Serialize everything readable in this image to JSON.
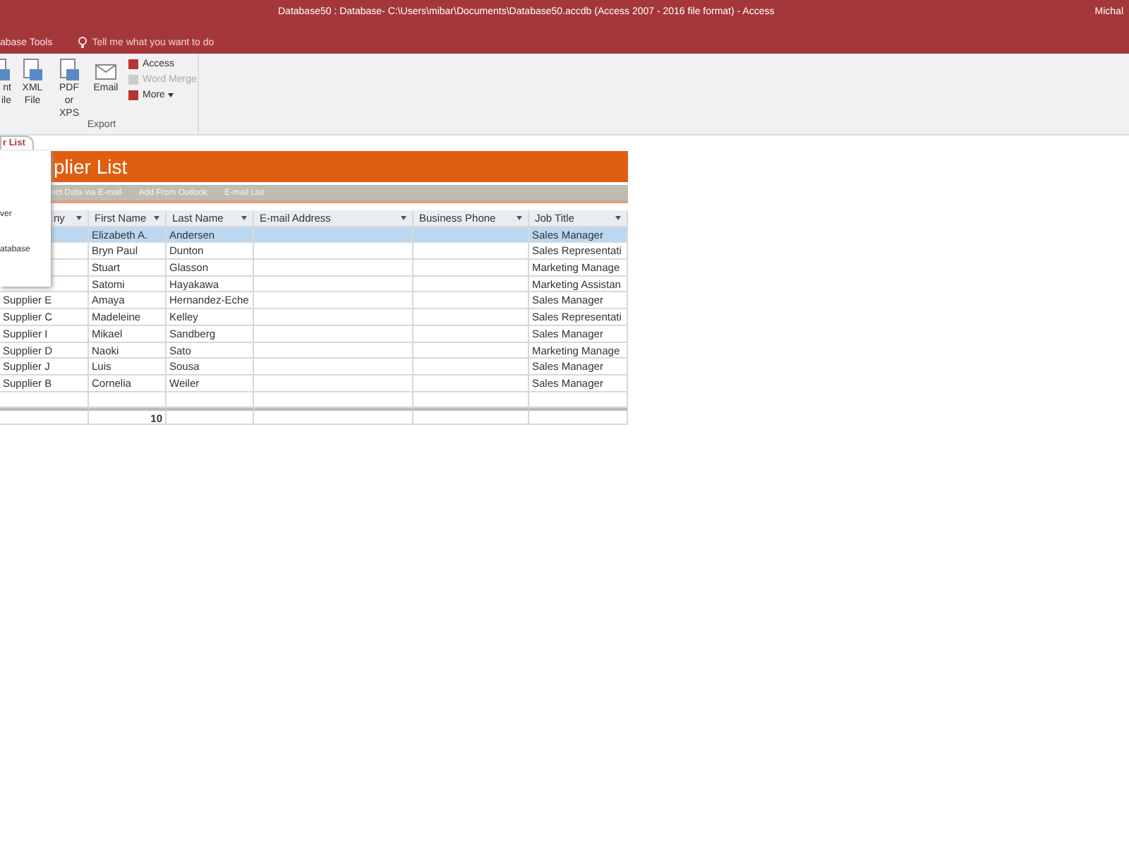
{
  "window": {
    "title": "Database50 : Database- C:\\Users\\mibar\\Documents\\Database50.accdb (Access 2007 - 2016 file format)  -  Access",
    "user": "Michal"
  },
  "ribbon_tabs": [
    {
      "label": "abase Tools"
    }
  ],
  "tell_me": {
    "placeholder": "Tell me what you want to do"
  },
  "ribbon": {
    "large_buttons": [
      {
        "lines": [
          "nt",
          "ile"
        ]
      },
      {
        "lines": [
          "XML",
          "File"
        ]
      },
      {
        "lines": [
          "PDF",
          "or XPS"
        ]
      },
      {
        "lines": [
          "Email"
        ]
      }
    ],
    "small_buttons": [
      {
        "label": "Access",
        "disabled": false,
        "caret": false
      },
      {
        "label": "Word Merge",
        "disabled": true,
        "caret": false
      },
      {
        "label": "More",
        "disabled": false,
        "caret": true
      }
    ],
    "group_label": "Export"
  },
  "document_tab": {
    "label": "r List",
    "selected": true
  },
  "form": {
    "title": "plier List",
    "actions": [
      "ect Data via E-mail",
      "Add From Outlook",
      "E-mail List"
    ]
  },
  "popup_menu": {
    "items": [
      "ver",
      "atabase"
    ]
  },
  "table": {
    "columns": [
      "ny",
      "First Name",
      "Last Name",
      "E-mail Address",
      "Business Phone",
      "Job Title"
    ],
    "rows": [
      {
        "cells": [
          "",
          "Elizabeth A.",
          "Andersen",
          "",
          "",
          "Sales Manager"
        ],
        "selected": true
      },
      {
        "cells": [
          "",
          "Bryn Paul",
          "Dunton",
          "",
          "",
          "Sales Representati"
        ],
        "selected": false
      },
      {
        "cells": [
          "",
          "Stuart",
          "Glasson",
          "",
          "",
          "Marketing Manage"
        ],
        "selected": false
      },
      {
        "cells": [
          "",
          "Satomi",
          "Hayakawa",
          "",
          "",
          "Marketing Assistan"
        ],
        "selected": false
      },
      {
        "cells": [
          "Supplier E",
          "Amaya",
          "Hernandez-Eche",
          "",
          "",
          "Sales Manager"
        ],
        "selected": false
      },
      {
        "cells": [
          "Supplier C",
          "Madeleine",
          "Kelley",
          "",
          "",
          "Sales Representati"
        ],
        "selected": false
      },
      {
        "cells": [
          "Supplier I",
          "Mikael",
          "Sandberg",
          "",
          "",
          "Sales Manager"
        ],
        "selected": false
      },
      {
        "cells": [
          "Supplier D",
          "Naoki",
          "Sato",
          "",
          "",
          "Marketing Manage"
        ],
        "selected": false
      },
      {
        "cells": [
          "Supplier J",
          "Luis",
          "Sousa",
          "",
          "",
          "Sales Manager"
        ],
        "selected": false
      },
      {
        "cells": [
          "Supplier B",
          "Cornelia",
          "Weiler",
          "",
          "",
          "Sales Manager"
        ],
        "selected": false
      }
    ],
    "total": {
      "cells": [
        "",
        "10",
        "",
        "",
        "",
        ""
      ]
    }
  }
}
